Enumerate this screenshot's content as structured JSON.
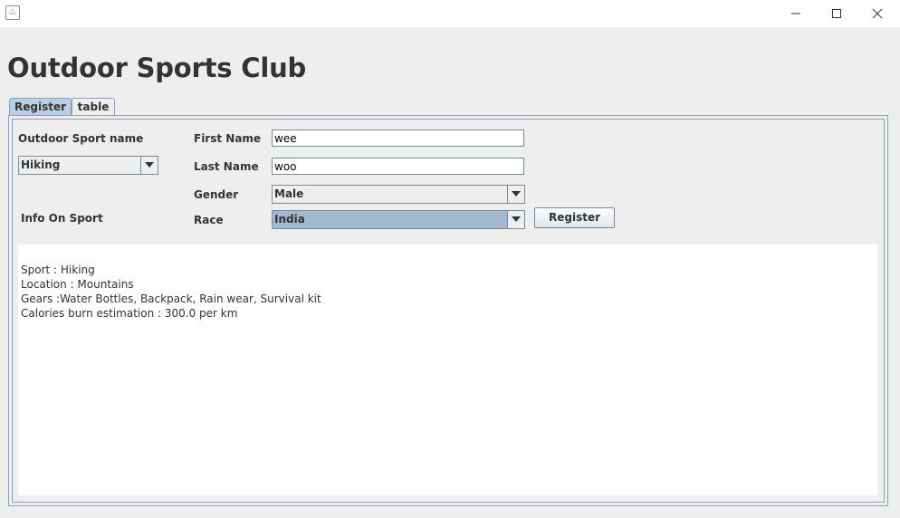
{
  "window": {
    "title": "",
    "icon": "java-cup-icon",
    "controls": [
      "minimize-icon",
      "maximize-icon",
      "close-icon"
    ]
  },
  "header": {
    "title": "Outdoor Sports Club"
  },
  "tabs": [
    {
      "label": "Register",
      "active": true
    },
    {
      "label": "table",
      "active": false
    }
  ],
  "form": {
    "sport_label": "Outdoor Sport name",
    "sport_value": "Hiking",
    "info_label": "Info On Sport",
    "first_name_label": "First Name",
    "first_name_value": "wee",
    "last_name_label": "Last Name",
    "last_name_value": "woo",
    "gender_label": "Gender",
    "gender_value": "Male",
    "race_label": "Race",
    "race_value": "India",
    "register_button": "Register"
  },
  "info": {
    "lines": [
      "Sport : Hiking",
      "Location : Mountains",
      "Gears :Water Bottles, Backpack, Rain wear, Survival kit",
      "Calories burn estimation : 300.0 per km"
    ]
  },
  "colors": {
    "active_tab": "#b8cfe5",
    "selected_combo": "#a3b8cc",
    "panel_border": "#8ea0b8",
    "background": "#eeeeee"
  }
}
